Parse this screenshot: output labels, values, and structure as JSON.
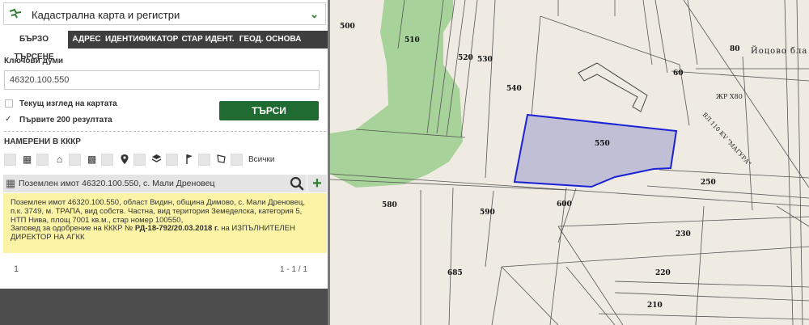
{
  "panel": {
    "layer_select": "Кадастрална карта и регистри",
    "tabs": [
      "БЪРЗО ТЪРСЕНЕ",
      "АДРЕС",
      "ИДЕНТИФИКАТОР",
      "СТАР ИДЕНТ.",
      "ГЕОД. ОСНОВА"
    ],
    "keywords_label": "Ключови думи",
    "keywords_value": "46320.100.550",
    "current_view_label": "Текущ изглед на картата",
    "first200_label": "Първите 200 резултата",
    "first200_checked": "✓",
    "search_button": "ТЪРСИ",
    "found_label": "НАМЕРЕНИ В КККР",
    "all_label": "Всички",
    "result_title": "Поземлен имот 46320.100.550, с. Мали Дреновец",
    "info": {
      "line1": "Поземлен имот 46320.100.550, област Видин, община Димово, с. Мали Дреновец,",
      "line2": "п.к. 3749, м. ТРАПА, вид собств. Частна, вид територия Земеделска, категория 5,",
      "line3": "НТП Нива, площ 7001 кв.м., стар номер 100550,",
      "line4_prefix": "Заповед за одобрение на КККР №",
      "line4_bold": "РД-18-792/20.03.2018 г.",
      "line4_suffix": "на ИЗПЪЛНИТЕЛЕН",
      "line5": "ДИРЕКТОР НА АГКК"
    },
    "pager_page": "1",
    "pager_range": "1 - 1 / 1"
  },
  "map": {
    "lots": [
      "500",
      "510",
      "520",
      "530",
      "540",
      "550",
      "580",
      "590",
      "600",
      "250",
      "230",
      "220",
      "210",
      "685",
      "80",
      "60"
    ],
    "labels": {
      "locality": "Йоцово бла",
      "building": "ЖР Х80",
      "street": "ВЛ 110 KV \"МАГУРА\""
    }
  },
  "colors": {
    "accent": "#1f6b31",
    "forest": "#a7d29a",
    "selection_fill": "#c0bfd6",
    "selection_stroke": "#1b22d6",
    "info_bg": "#fbf4a6"
  }
}
